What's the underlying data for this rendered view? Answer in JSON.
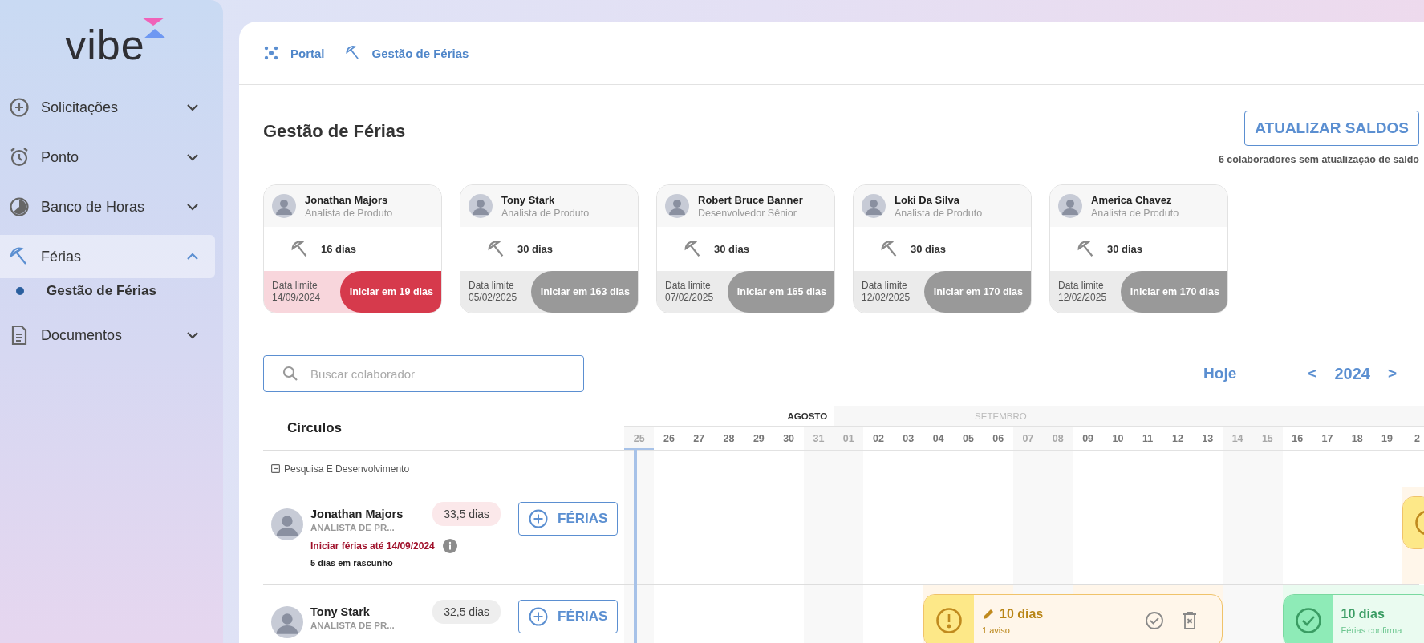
{
  "sidebar": {
    "logo": "vibe",
    "items": [
      {
        "label": "Solicitações",
        "expanded": false,
        "selected": false
      },
      {
        "label": "Ponto",
        "expanded": false,
        "selected": false
      },
      {
        "label": "Banco de Horas",
        "expanded": false,
        "selected": false
      },
      {
        "label": "Férias",
        "expanded": true,
        "selected": true,
        "children": [
          {
            "label": "Gestão de Férias",
            "selected": true
          }
        ]
      },
      {
        "label": "Documentos",
        "expanded": false,
        "selected": false
      }
    ]
  },
  "breadcrumb": [
    {
      "label": "Portal"
    },
    {
      "label": "Gestão de Férias"
    }
  ],
  "page_title": "Gestão de Férias",
  "update_button": "ATUALIZAR SALDOS",
  "update_note": "6 colaboradores sem atualização de saldo",
  "cards": [
    {
      "name": "Jonathan Majors",
      "role": "Analista de Produto",
      "days": "16 dias",
      "deadline_label": "Data limite",
      "deadline": "14/09/2024",
      "start_in": "Iniciar em 19 dias",
      "urgent": true
    },
    {
      "name": "Tony Stark",
      "role": "Analista de Produto",
      "days": "30 dias",
      "deadline_label": "Data limite",
      "deadline": "05/02/2025",
      "start_in": "Iniciar em 163 dias",
      "urgent": false
    },
    {
      "name": "Robert Bruce Banner",
      "role": "Desenvolvedor Sênior",
      "days": "30 dias",
      "deadline_label": "Data limite",
      "deadline": "07/02/2025",
      "start_in": "Iniciar em 165 dias",
      "urgent": false
    },
    {
      "name": "Loki Da Silva",
      "role": "Analista de Produto",
      "days": "30 dias",
      "deadline_label": "Data limite",
      "deadline": "12/02/2025",
      "start_in": "Iniciar em 170 dias",
      "urgent": false
    },
    {
      "name": "America Chavez",
      "role": "Analista de Produto",
      "days": "30 dias",
      "deadline_label": "Data limite",
      "deadline": "12/02/2025",
      "start_in": "Iniciar em 170 dias",
      "urgent": false
    }
  ],
  "search": {
    "placeholder": "Buscar colaborador"
  },
  "calendar": {
    "today_button": "Hoje",
    "prev": "<",
    "year": "2024",
    "next": ">"
  },
  "timeline": {
    "column_header": "Círculos",
    "months": [
      {
        "label": "AGOSTO",
        "current": true,
        "days": [
          {
            "label": "25",
            "weekend": true,
            "today": true
          },
          {
            "label": "26",
            "weekend": false,
            "today": false
          },
          {
            "label": "27",
            "weekend": false,
            "today": false
          },
          {
            "label": "28",
            "weekend": false,
            "today": false
          },
          {
            "label": "29",
            "weekend": false,
            "today": false
          },
          {
            "label": "30",
            "weekend": false,
            "today": false
          },
          {
            "label": "31",
            "weekend": true,
            "today": false
          }
        ]
      },
      {
        "label": "SETEMBRO",
        "current": false,
        "days": [
          {
            "label": "01",
            "weekend": true,
            "today": false
          },
          {
            "label": "02",
            "weekend": false,
            "today": false
          },
          {
            "label": "03",
            "weekend": false,
            "today": false
          },
          {
            "label": "04",
            "weekend": false,
            "today": false
          },
          {
            "label": "05",
            "weekend": false,
            "today": false
          },
          {
            "label": "06",
            "weekend": false,
            "today": false
          },
          {
            "label": "07",
            "weekend": true,
            "today": false
          },
          {
            "label": "08",
            "weekend": true,
            "today": false
          },
          {
            "label": "09",
            "weekend": false,
            "today": false
          },
          {
            "label": "10",
            "weekend": false,
            "today": false
          },
          {
            "label": "11",
            "weekend": false,
            "today": false
          },
          {
            "label": "12",
            "weekend": false,
            "today": false
          },
          {
            "label": "13",
            "weekend": false,
            "today": false
          },
          {
            "label": "14",
            "weekend": true,
            "today": false
          },
          {
            "label": "15",
            "weekend": true,
            "today": false
          },
          {
            "label": "16",
            "weekend": false,
            "today": false
          },
          {
            "label": "17",
            "weekend": false,
            "today": false
          },
          {
            "label": "18",
            "weekend": false,
            "today": false
          },
          {
            "label": "19",
            "weekend": false,
            "today": false
          },
          {
            "label": "2",
            "weekend": false,
            "today": false
          }
        ]
      }
    ],
    "group": {
      "label": "Pesquisa E Desenvolvimento",
      "expanded": true
    },
    "rows": [
      {
        "name": "Jonathan Majors",
        "role": "ANALISTA DE PR...",
        "balance": "33,5 dias",
        "urgent": true,
        "add_button": "FÉRIAS",
        "deadline_note": "Iniciar férias até 14/09/2024",
        "draft_note": "5 dias em rascunho",
        "days": [
          {
            "kind": "free"
          },
          {
            "kind": "free"
          },
          {
            "kind": "free"
          },
          {
            "kind": "free"
          },
          {
            "kind": "free"
          },
          {
            "kind": "free"
          },
          {
            "kind": "free"
          },
          {
            "kind": "free"
          },
          {
            "kind": "free"
          },
          {
            "kind": "free"
          },
          {
            "kind": "free"
          },
          {
            "kind": "free"
          },
          {
            "kind": "free"
          },
          {
            "kind": "free"
          },
          {
            "kind": "free"
          },
          {
            "kind": "free"
          },
          {
            "kind": "free"
          },
          {
            "kind": "free"
          },
          {
            "kind": "free"
          },
          {
            "kind": "free"
          },
          {
            "kind": "free"
          },
          {
            "kind": "free"
          },
          {
            "kind": "free"
          },
          {
            "kind": "free"
          },
          {
            "kind": "free"
          },
          {
            "kind": "free"
          },
          {
            "kind": "draft"
          }
        ]
      },
      {
        "name": "Tony Stark",
        "role": "ANALISTA DE PR...",
        "balance": "32,5 dias",
        "urgent": false,
        "add_button": "FÉRIAS",
        "days": [
          {
            "kind": "free"
          },
          {
            "kind": "free"
          },
          {
            "kind": "free"
          },
          {
            "kind": "free"
          },
          {
            "kind": "free"
          },
          {
            "kind": "free"
          },
          {
            "kind": "free"
          },
          {
            "kind": "free"
          },
          {
            "kind": "free"
          },
          {
            "kind": "free"
          },
          {
            "kind": "draft"
          },
          {
            "kind": "draft"
          },
          {
            "kind": "draft"
          },
          {
            "kind": "draft"
          },
          {
            "kind": "draft"
          },
          {
            "kind": "draft"
          },
          {
            "kind": "draft"
          },
          {
            "kind": "draft"
          },
          {
            "kind": "draft"
          },
          {
            "kind": "draft"
          },
          {
            "kind": "free"
          },
          {
            "kind": "free"
          },
          {
            "kind": "confirmed"
          },
          {
            "kind": "confirmed"
          },
          {
            "kind": "confirmed"
          },
          {
            "kind": "confirmed"
          },
          {
            "kind": "confirmed"
          }
        ],
        "bars": [
          {
            "days": "10 dias",
            "note": "1 aviso"
          },
          {
            "days": "10 dias",
            "note": "Férias confirma"
          }
        ]
      }
    ]
  }
}
